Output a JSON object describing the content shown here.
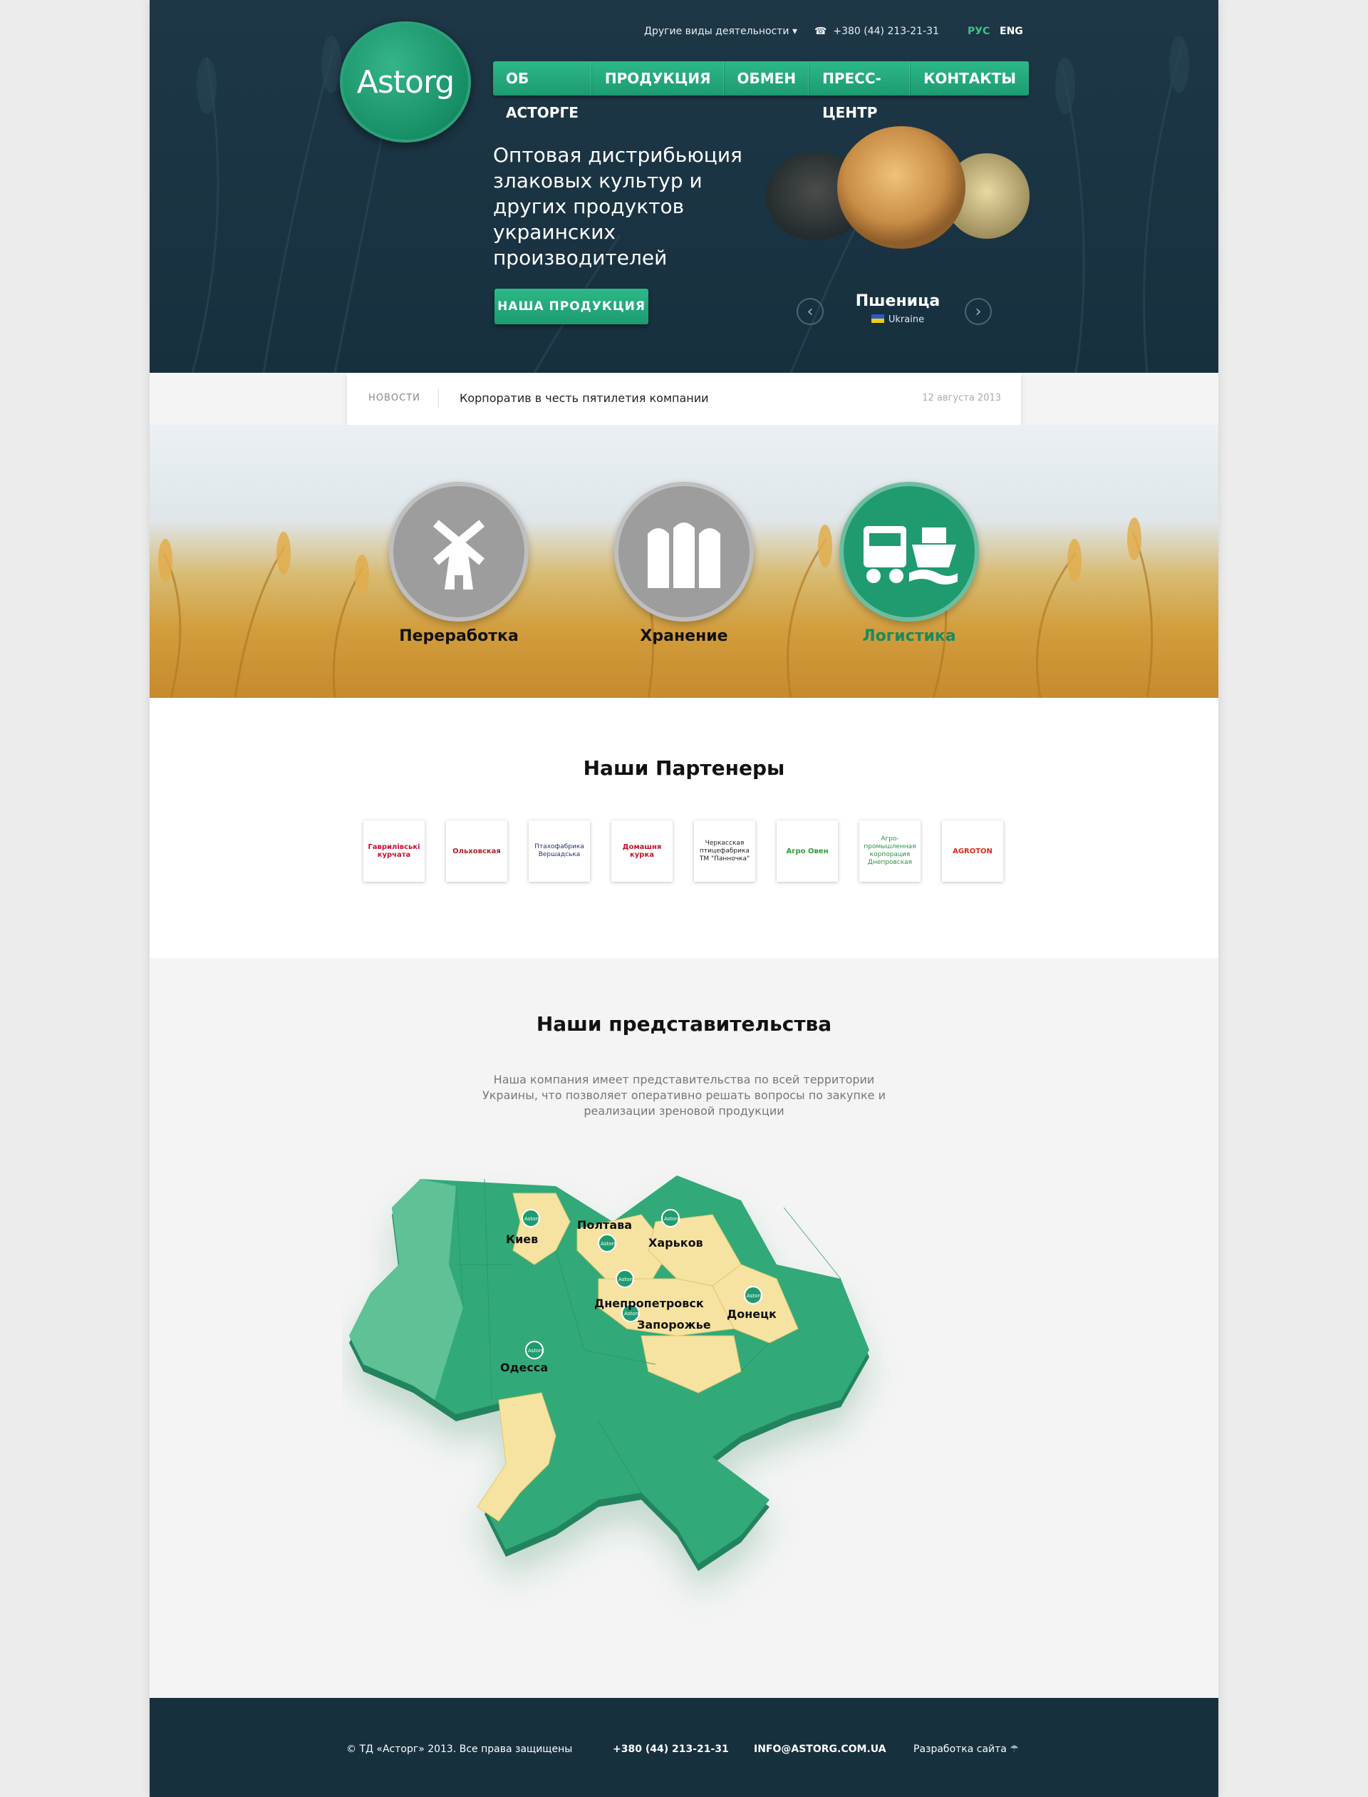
{
  "header": {
    "logo_text": "Astorg",
    "other_activities": "Другие виды деятельности",
    "phone": "+380 (44) 213-21-31",
    "lang_ru": "РУС",
    "lang_en": "ENG",
    "nav": [
      "ОБ АСТОРГЕ",
      "ПРОДУКЦИЯ",
      "ОБМЕН",
      "ПРЕСС-ЦЕНТР",
      "КОНТАКТЫ"
    ],
    "tagline": "Оптовая дистрибьюция злаковых культур и других продуктов украинских производителей",
    "cta": "НАША ПРОДУКЦИЯ",
    "product_name": "Пшеница",
    "product_origin": "Ukraine"
  },
  "news": {
    "label": "НОВОСТИ",
    "title": "Корпоратив в честь пятилетия компании",
    "date": "12 августа 2013"
  },
  "services": [
    "Переработка",
    "Хранение",
    "Логистика"
  ],
  "partners": {
    "title": "Наши Партенеры",
    "logos": [
      "Гаврилівські курчата",
      "Ольховская",
      "Птахофабрика Вершадська",
      "Домашня курка",
      "Черкасская птицефабрика ТМ \"Панночка\"",
      "Агро Овен",
      "Агро-промышленная корпорация Днепровская",
      "AGROTON"
    ]
  },
  "offices": {
    "title": "Наши представительства",
    "description": "Наша компания имеет представительства по всей территории Украины, что позволяет оперативно решать вопросы по закупке и реализации зреновой продукции",
    "marker_label": "Astorg",
    "cities": [
      "Киев",
      "Полтава",
      "Харьков",
      "Донецк",
      "Днепропетровск",
      "Запорожье",
      "Одесса"
    ]
  },
  "footer": {
    "copyright": "© ТД «Асторг» 2013. Все права защищены",
    "phone": "+380 (44) 213-21-31",
    "email": "INFO@ASTORG.COM.UA",
    "dev": "Разработка сайта"
  },
  "colors": {
    "accent": "#1f9b6f",
    "dark": "#1b3444",
    "region_yellow": "#f6e3a1",
    "region_green": "#33a978"
  }
}
